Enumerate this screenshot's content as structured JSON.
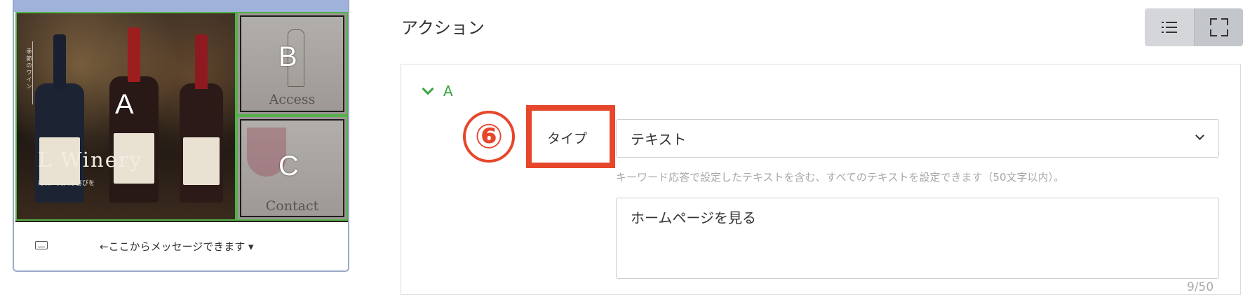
{
  "preview": {
    "richmenu": {
      "area_a": {
        "letter": "A",
        "vertical_text": "季節のワイン",
        "brand": "L Winery",
        "tagline": "毎日に贅沢な喜びを"
      },
      "area_b": {
        "letter": "B",
        "caption": "Access"
      },
      "area_c": {
        "letter": "C",
        "caption": "Contact"
      }
    },
    "chatbar": {
      "icon": "keyboard-icon",
      "text": "←ここからメッセージできます ▾"
    }
  },
  "section": {
    "title": "アクション",
    "view_toggle": [
      {
        "icon": "list-icon",
        "active": false
      },
      {
        "icon": "expand-icon",
        "active": true
      }
    ]
  },
  "action": {
    "area_label": "A",
    "step_marker": "⑥",
    "type_label": "タイプ",
    "type_value": "テキスト",
    "help_text": "キーワード応答で設定したテキストを含む、すべてのテキストを設定できます（50文字以内）。",
    "text_value": "ホームページを見る",
    "counter": "9/50"
  },
  "colors": {
    "accent_green": "#3aa640",
    "highlight_red": "#e6472b",
    "border_gray": "#cfcfcf"
  }
}
